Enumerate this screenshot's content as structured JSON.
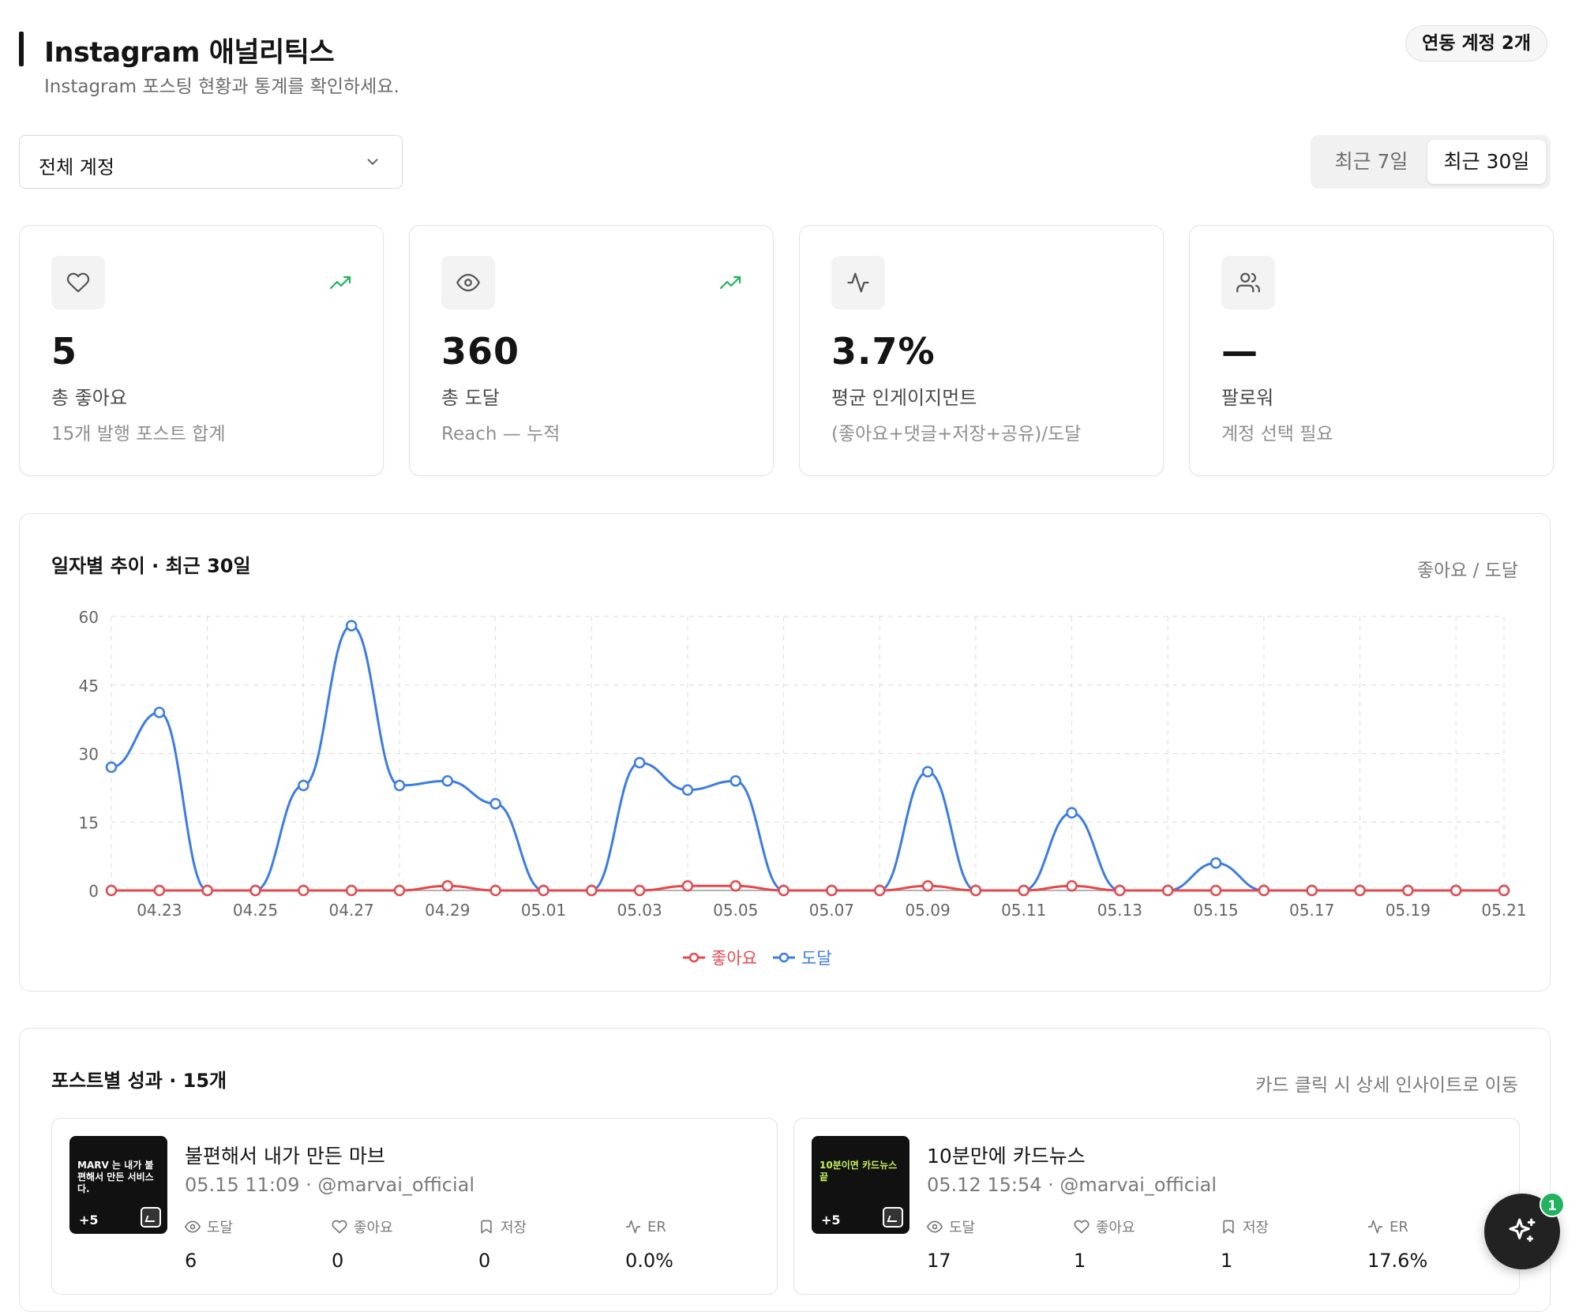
{
  "header": {
    "title": "Instagram 애널리틱스",
    "subtitle": "Instagram 포스팅 현황과 통계를 확인하세요.",
    "linked_accounts_badge": "연동 계정 2개"
  },
  "filters": {
    "account_select": "전체 계정",
    "ranges": [
      "최근 7일",
      "최근 30일"
    ],
    "active_range": "최근 30일"
  },
  "stats": [
    {
      "icon": "heart-icon",
      "value": "5",
      "label": "총 좋아요",
      "desc": "15개 발행 포스트 합계",
      "trend": true
    },
    {
      "icon": "eye-icon",
      "value": "360",
      "label": "총 도달",
      "desc": "Reach — 누적",
      "trend": true
    },
    {
      "icon": "activity-icon",
      "value": "3.7%",
      "label": "평균 인게이지먼트",
      "desc": "(좋아요+댓글+저장+공유)/도달",
      "trend": false
    },
    {
      "icon": "users-icon",
      "value": "—",
      "label": "팔로워",
      "desc": "계정 선택 필요",
      "trend": false
    }
  ],
  "chart_section": {
    "title": "일자별 추이 · 최근 30일",
    "metric_label": "좋아요 / 도달"
  },
  "chart_data": {
    "type": "line",
    "x": [
      "04.22",
      "04.23",
      "04.24",
      "04.25",
      "04.26",
      "04.27",
      "04.28",
      "04.29",
      "04.30",
      "05.01",
      "05.02",
      "05.03",
      "05.04",
      "05.05",
      "05.06",
      "05.07",
      "05.08",
      "05.09",
      "05.10",
      "05.11",
      "05.12",
      "05.13",
      "05.14",
      "05.15",
      "05.16",
      "05.17",
      "05.18",
      "05.19",
      "05.20",
      "05.21"
    ],
    "x_tick_labels": [
      "04.23",
      "04.25",
      "04.27",
      "04.29",
      "05.01",
      "05.03",
      "05.05",
      "05.07",
      "05.09",
      "05.11",
      "05.13",
      "05.15",
      "05.17",
      "05.19",
      "05.21"
    ],
    "series": [
      {
        "name": "좋아요",
        "color": "#e5484d",
        "values": [
          0,
          0,
          0,
          0,
          0,
          0,
          0,
          1,
          0,
          0,
          0,
          0,
          1,
          1,
          0,
          0,
          0,
          1,
          0,
          0,
          1,
          0,
          0,
          0,
          0,
          0,
          0,
          0,
          0,
          0
        ]
      },
      {
        "name": "도달",
        "color": "#3b7ce6",
        "values": [
          27,
          39,
          0,
          0,
          23,
          58,
          23,
          24,
          19,
          0,
          0,
          28,
          22,
          24,
          0,
          0,
          0,
          26,
          0,
          0,
          17,
          0,
          0,
          6,
          0,
          0,
          0,
          0,
          0,
          0
        ]
      }
    ],
    "ylim": [
      0,
      60
    ],
    "yticks": [
      0,
      15,
      30,
      45,
      60
    ],
    "grid": true,
    "legend_position": "bottom-center"
  },
  "posts_section": {
    "title": "포스트별 성과 · 15개",
    "hint": "카드 클릭 시 상세 인사이트로 이동",
    "metric_labels": {
      "reach": "도달",
      "likes": "좋아요",
      "saves": "저장",
      "er": "ER"
    },
    "posts": [
      {
        "title": "불편해서 내가 만든 마브",
        "meta": "05.15 11:09 · @marvai_official",
        "thumb_text": "MARV 는 내가 불편해서 만든 서비스다.",
        "thumb_more": "+5",
        "reach": "6",
        "likes": "0",
        "saves": "0",
        "er": "0.0%"
      },
      {
        "title": "10분만에 카드뉴스",
        "meta": "05.12 15:54 · @marvai_official",
        "thumb_text": "10분이면 카드뉴스 끝",
        "thumb_more": "+5",
        "reach": "17",
        "likes": "1",
        "saves": "1",
        "er": "17.6%"
      }
    ]
  },
  "fab": {
    "icon": "sparkle-icon",
    "badge": "1"
  }
}
